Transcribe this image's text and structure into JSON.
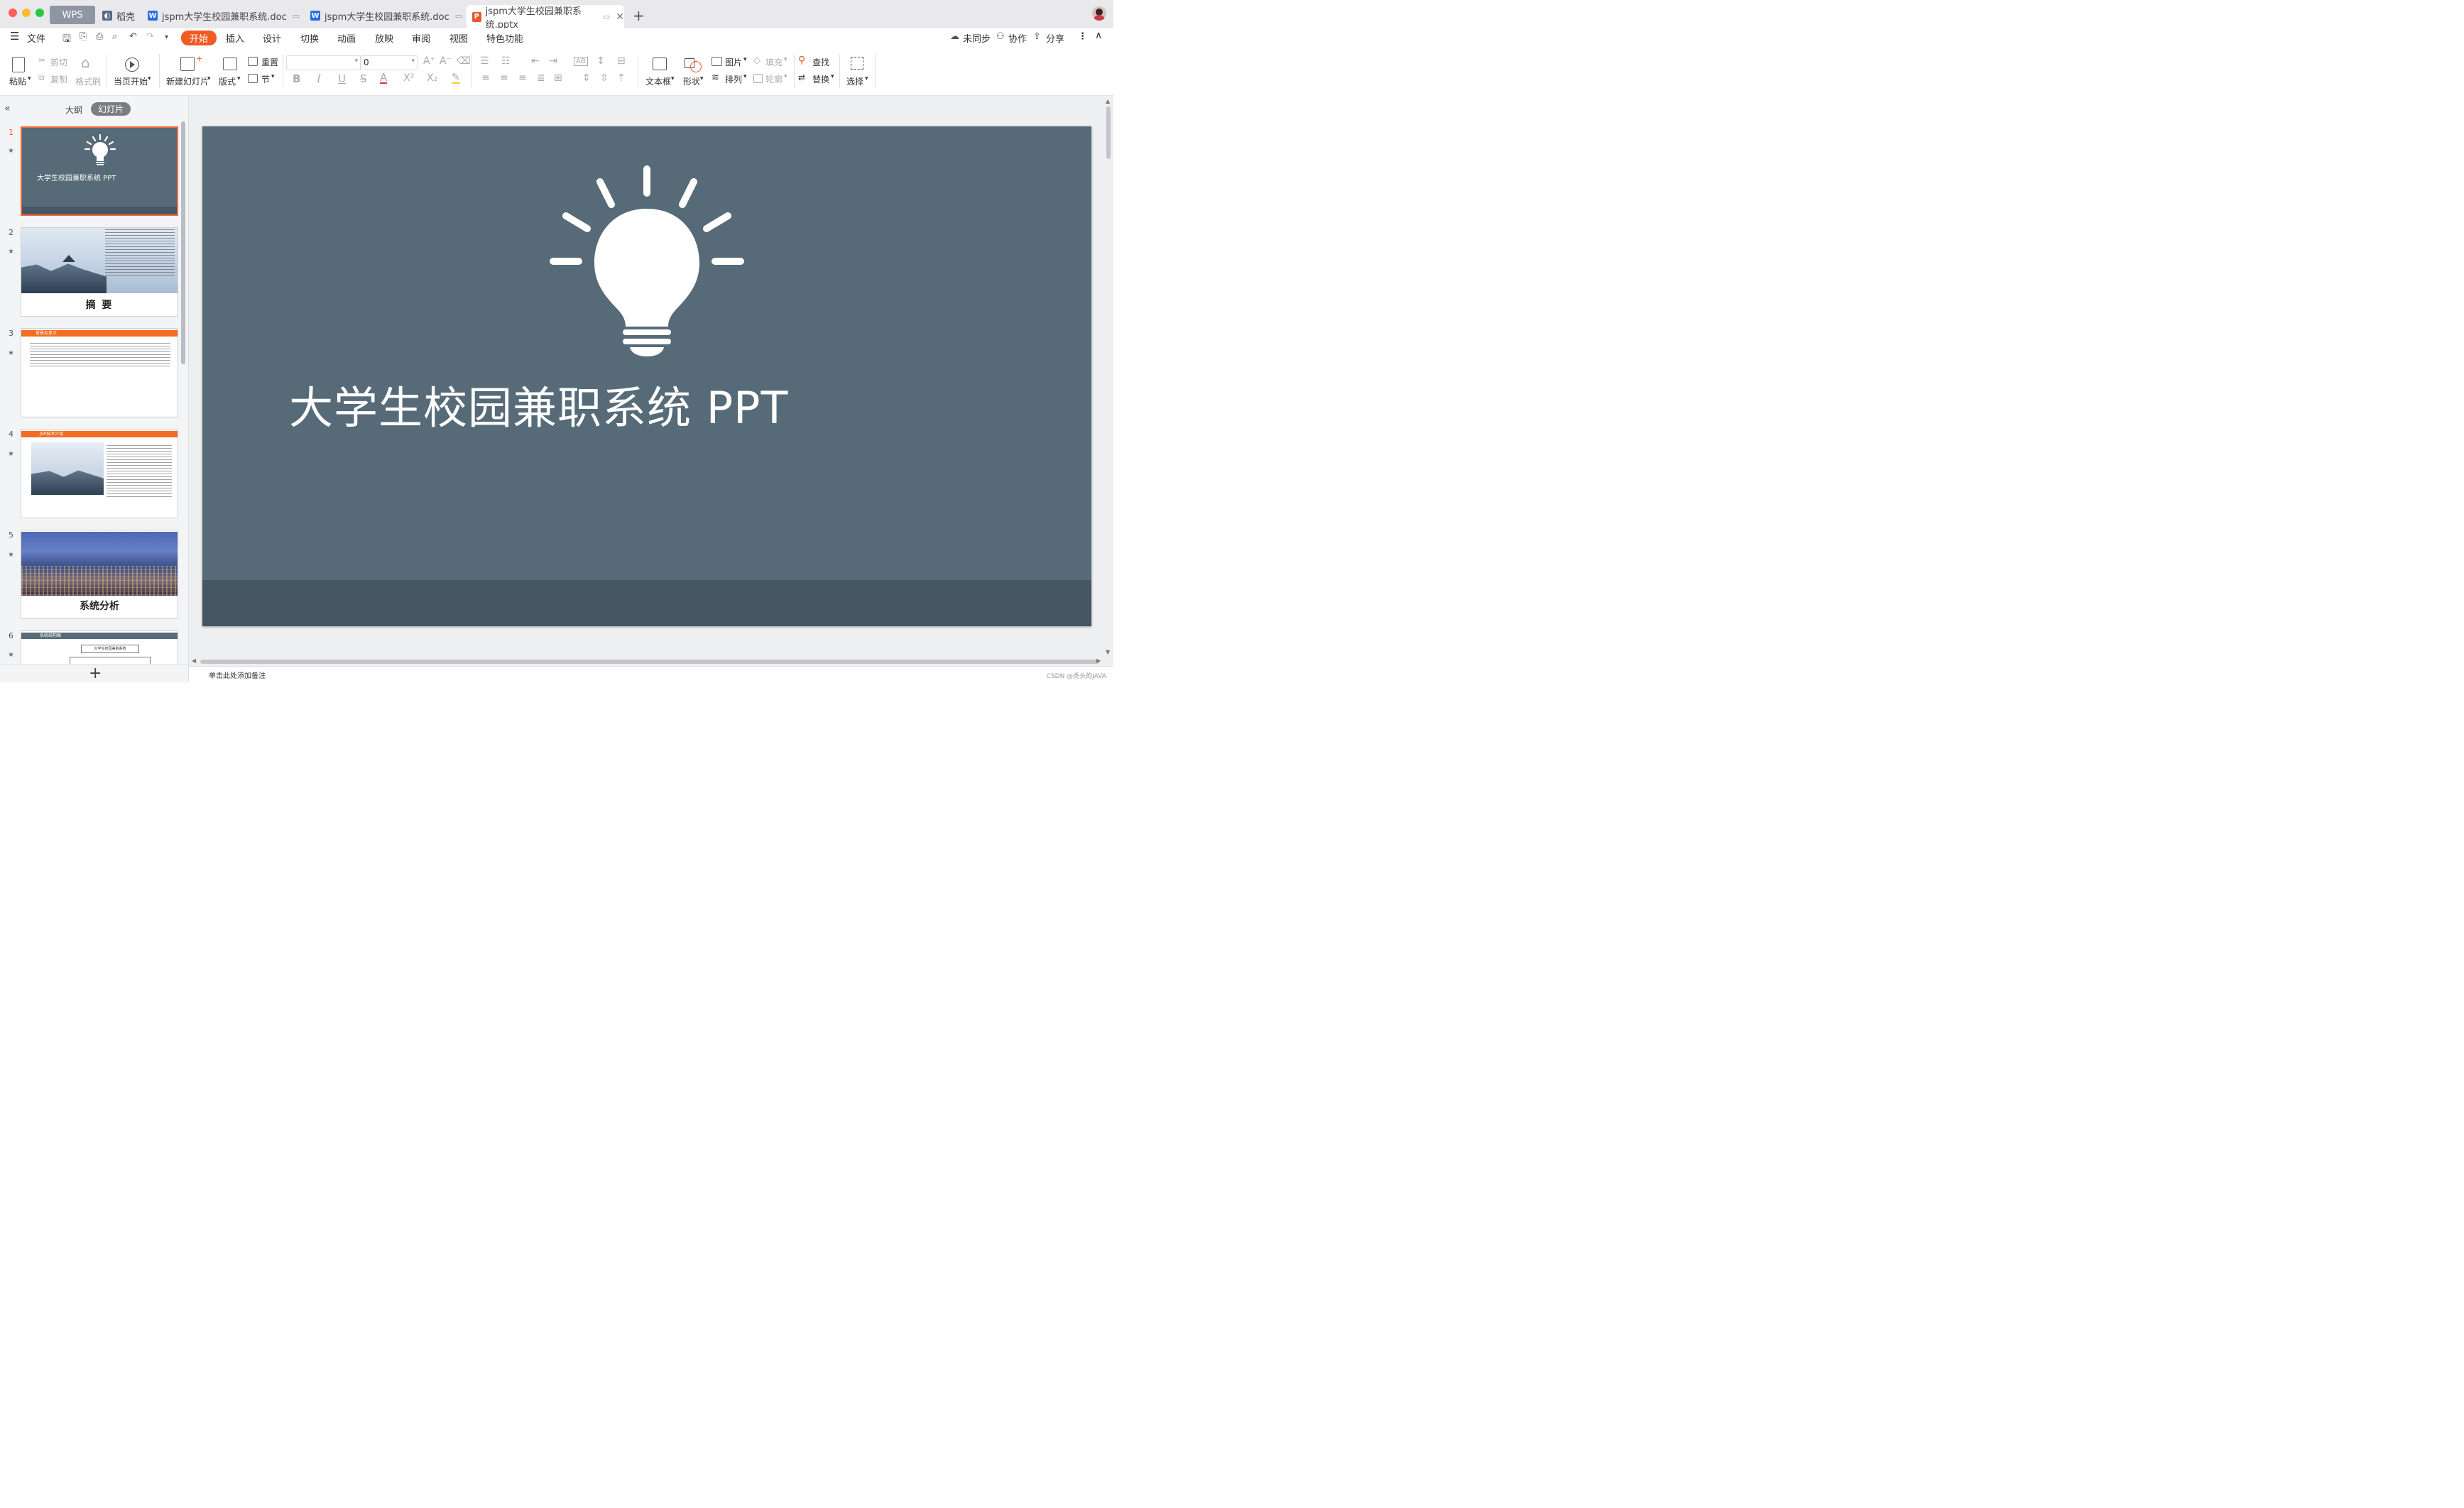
{
  "titlebar": {
    "tabs": [
      {
        "label": "WPS"
      },
      {
        "label": "稻壳"
      },
      {
        "label": "jspm大学生校园兼职系统.doc"
      },
      {
        "label": "jspm大学生校园兼职系统.doc"
      },
      {
        "label": "jspm大学生校园兼职系统.pptx"
      }
    ],
    "new_tab": "+"
  },
  "menubar": {
    "file": "文件",
    "items": [
      "开始",
      "插入",
      "设计",
      "切换",
      "动画",
      "放映",
      "审阅",
      "视图",
      "特色功能"
    ],
    "right": {
      "sync": "未同步",
      "collab": "协作",
      "share": "分享"
    }
  },
  "ribbon": {
    "paste": "粘贴",
    "cut": "剪切",
    "copy": "复制",
    "format_painter": "格式刷",
    "play_from_current": "当页开始",
    "new_slide": "新建幻灯片",
    "layout": "版式",
    "reset": "重置",
    "section": "节",
    "font_size_value": "0",
    "text_box": "文本框",
    "shape": "形状",
    "picture": "图片",
    "arrange": "排列",
    "fill": "填充",
    "outline": "轮廓",
    "find": "查找",
    "replace": "替换",
    "select": "选择"
  },
  "leftpanel": {
    "outline_tab": "大纲",
    "slides_tab": "幻灯片",
    "add": "+",
    "thumbs": [
      {
        "num": "1",
        "title": "大学生校园兼职系统 PPT"
      },
      {
        "num": "2",
        "title": "摘    要"
      },
      {
        "num": "3",
        "header": "背景及意义"
      },
      {
        "num": "4",
        "header": "JSP技术介绍"
      },
      {
        "num": "5",
        "title": "系统分析"
      },
      {
        "num": "6",
        "header": "系统结构图",
        "box": "大学生校园兼职系统"
      }
    ]
  },
  "slide": {
    "title": "大学生校园兼职系统 PPT"
  },
  "notes": {
    "placeholder": "单击此处添加备注"
  },
  "watermark": "CSDN @秃头的JAVA",
  "colors": {
    "slide_bg": "#566b77",
    "slide_footer": "#465662",
    "accent": "#f05a24"
  }
}
